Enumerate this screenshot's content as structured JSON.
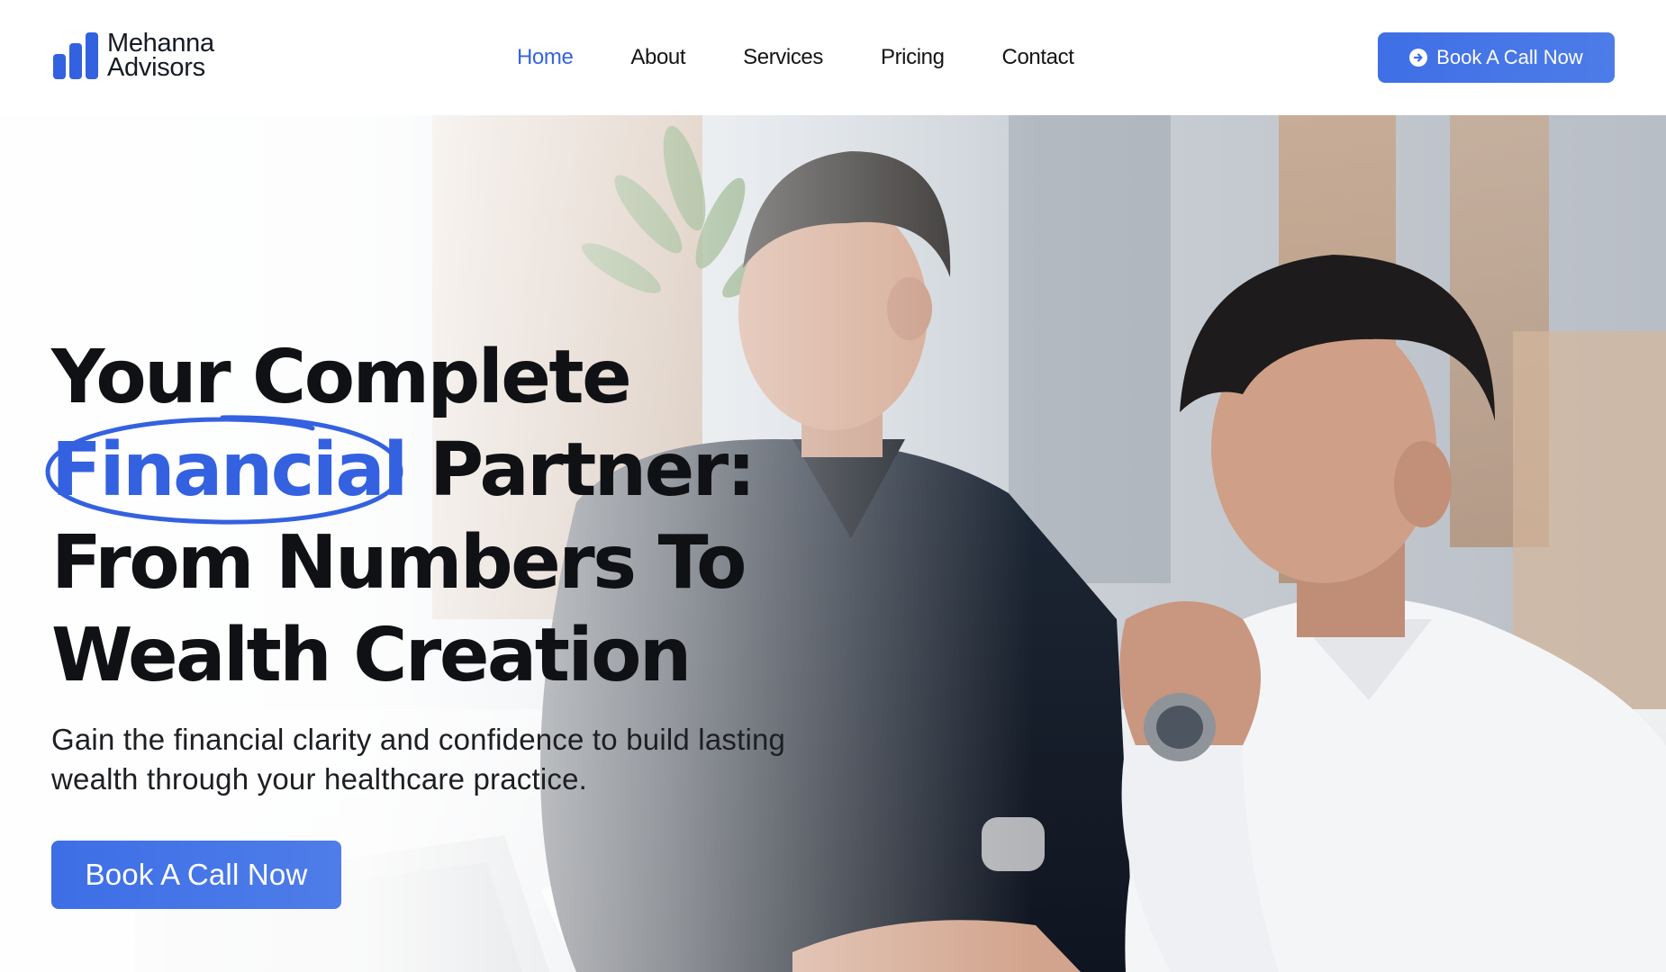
{
  "brand": {
    "name_line1": "Mehanna",
    "name_line2": "Advisors",
    "accent_color": "#3564e0"
  },
  "nav": {
    "items": [
      {
        "label": "Home",
        "active": true
      },
      {
        "label": "About",
        "active": false
      },
      {
        "label": "Services",
        "active": false
      },
      {
        "label": "Pricing",
        "active": false
      },
      {
        "label": "Contact",
        "active": false
      }
    ]
  },
  "header": {
    "cta_label": "Book A Call Now",
    "cta_icon": "arrow-right-circle-icon"
  },
  "hero": {
    "headline_line1": "Your Complete",
    "headline_highlight": "Financial",
    "headline_line2_rest": "Partner:",
    "headline_line3": "From Numbers To",
    "headline_line4": "Wealth Creation",
    "subtext": "Gain the financial clarity and confidence to build lasting wealth through your healthcare practice.",
    "cta_label": "Book A Call Now",
    "image": "two-men-reviewing-financial-documents"
  }
}
